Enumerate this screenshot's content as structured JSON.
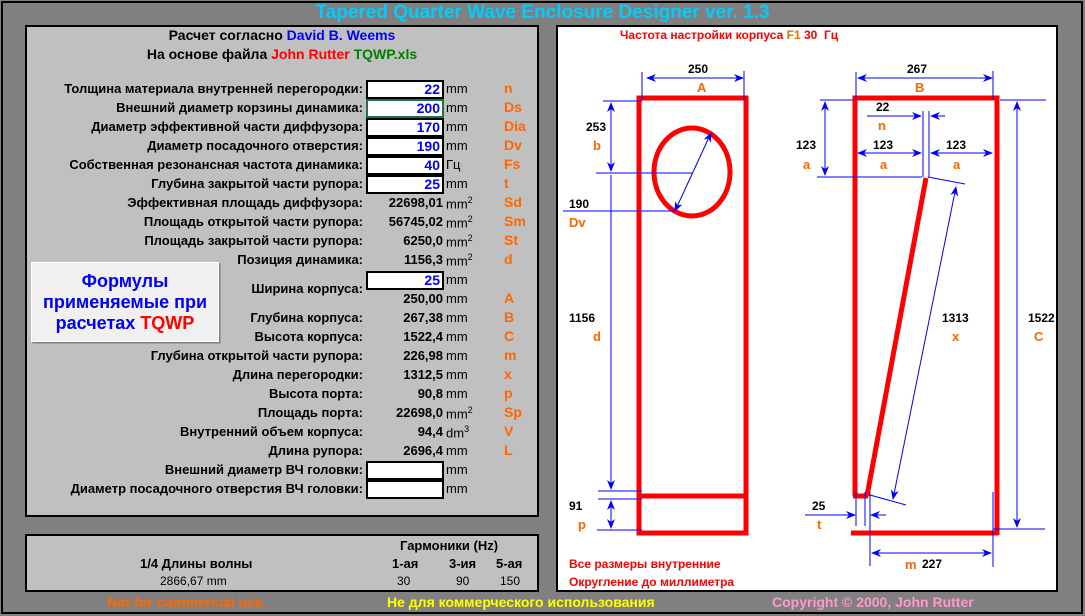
{
  "title": "Tapered Quarter Wave Enclosure Designer ver. 1.3",
  "header": {
    "line1_prefix": "Расчет согласно",
    "line1_author": "David B. Weems",
    "line2_prefix": "На основе файла",
    "line2_author": "John Rutter",
    "line2_file": "TQWP.xls"
  },
  "inputs": [
    {
      "label": "Толщина материала внутренней перегородки:",
      "value": "22",
      "unit": "mm",
      "symbol": "n"
    },
    {
      "label": "Внешний диаметр корзины динамика:",
      "value": "200",
      "unit": "mm",
      "symbol": "Ds"
    },
    {
      "label": "Диаметр эффективной части диффузора:",
      "value": "170",
      "unit": "mm",
      "symbol": "Dia"
    },
    {
      "label": "Диаметр посадочного отверстия:",
      "value": "190",
      "unit": "mm",
      "symbol": "Dv"
    },
    {
      "label": "Собственная резонансная частота динамика:",
      "value": "40",
      "unit": "Гц",
      "symbol": "Fs"
    },
    {
      "label": "Глубина закрытой части рупора:",
      "value": "25",
      "unit": "mm",
      "symbol": "t"
    }
  ],
  "results1": [
    {
      "label": "Эффективная площадь диффузора:",
      "value": "22698,01",
      "unit": "mm",
      "sup": "2",
      "symbol": "Sd"
    },
    {
      "label": "Площадь открытой части рупора:",
      "value": "56745,02",
      "unit": "mm",
      "sup": "2",
      "symbol": "Sm"
    },
    {
      "label": "Площадь закрытой части рупора:",
      "value": "6250,0",
      "unit": "mm",
      "sup": "2",
      "symbol": "St"
    },
    {
      "label": "Позиция динамика:",
      "value": "1156,3",
      "unit": "mm",
      "sup": "2",
      "symbol": "d"
    }
  ],
  "width": {
    "label": "Ширина корпуса:",
    "input": "25",
    "input_unit": "mm",
    "value": "250,00",
    "unit": "mm",
    "symbol": "A"
  },
  "results2": [
    {
      "label": "Глубина корпуса:",
      "value": "267,38",
      "unit": "mm",
      "sup": "",
      "symbol": "B"
    },
    {
      "label": "Высота корпуса:",
      "value": "1522,4",
      "unit": "mm",
      "sup": "",
      "symbol": "C"
    },
    {
      "label": "Глубина открытой части рупора:",
      "value": "226,98",
      "unit": "mm",
      "sup": "",
      "symbol": "m"
    },
    {
      "label": "Длина перегородки:",
      "value": "1312,5",
      "unit": "mm",
      "sup": "",
      "symbol": "x"
    },
    {
      "label": "Высота порта:",
      "value": "90,8",
      "unit": "mm",
      "sup": "",
      "symbol": "p"
    },
    {
      "label": "Площадь порта:",
      "value": "22698,0",
      "unit": "mm",
      "sup": "2",
      "symbol": "Sp"
    },
    {
      "label": "Внутренний объем корпуса:",
      "value": "94,4",
      "unit": "dm",
      "sup": "3",
      "symbol": "V"
    },
    {
      "label": "Длина рупора:",
      "value": "2696,4",
      "unit": "mm",
      "sup": "",
      "symbol": "L"
    }
  ],
  "tweeter": [
    {
      "label": "Внешний диаметр ВЧ головки:",
      "value": "",
      "unit": "mm"
    },
    {
      "label": "Диаметр посадочного отверстия ВЧ головки:",
      "value": "",
      "unit": "mm"
    }
  ],
  "formula_button": {
    "line1": "Формулы",
    "line2": "применяемые при",
    "line3": "расчетах",
    "accent": "TQWP"
  },
  "harmonics": {
    "title": "Гармоники (Hz)",
    "wave_label": "1/4 Длины волны",
    "wave_value": "2866,67 mm",
    "cols": [
      "1-ая",
      "3-ия",
      "5-ая"
    ],
    "values": [
      "30",
      "90",
      "150"
    ]
  },
  "diagram": {
    "title_prefix": "Частота настройки корпуса",
    "title_f": "F1",
    "title_value": "30",
    "title_unit": "Гц",
    "A": "250",
    "A_sym": "A",
    "B": "267",
    "B_sym": "B",
    "b": "253",
    "b_sym": "b",
    "Dv": "190",
    "Dv_sym": "Dv",
    "d": "1156",
    "d_sym": "d",
    "p": "91",
    "p_sym": "p",
    "a_left": "123",
    "a_sym": "a",
    "n": "22",
    "n_sym": "n",
    "x": "1313",
    "x_sym": "x",
    "C": "1522",
    "C_sym": "C",
    "t": "25",
    "t_sym": "t",
    "m": "227",
    "m_sym": "m",
    "note1": "Все размеры внутренние",
    "note2": "Округление до миллиметра"
  },
  "footer": {
    "english": "Not for commercial use.",
    "russian": "Не для коммерческого использования",
    "copyright": "Copyright © 2000, John Rutter"
  },
  "colors": {
    "background": "#808080",
    "panel": "#c0c0c0",
    "title": "#00ccff",
    "input_text": "#0000ff",
    "symbol": "#ff6600",
    "drawing": "#ff0000",
    "dimension": "#0000ff"
  }
}
